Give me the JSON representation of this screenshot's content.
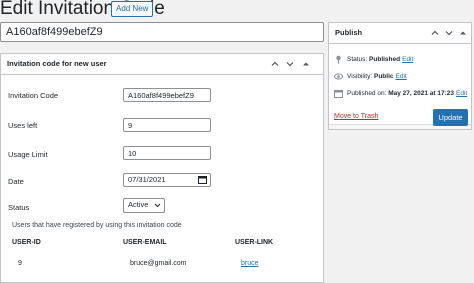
{
  "header": {
    "page_title": "Edit Invitation Code",
    "add_new_label": "Add New"
  },
  "post_title": "A160af8f499ebefZ9",
  "meta_box": {
    "title": "Invitation code for new user",
    "fields": {
      "invitation_code": {
        "label": "Invitation Code",
        "value": "A160af8f499ebefZ9"
      },
      "uses_left": {
        "label": "Uses left",
        "value": "9"
      },
      "usage_limit": {
        "label": "Usage Limit",
        "value": "10"
      },
      "date": {
        "label": "Date",
        "value": "07/31/2021"
      },
      "status": {
        "label": "Status",
        "value": "Active",
        "options": [
          "Active"
        ]
      }
    },
    "users_text": "Users that have registered by using this invitation code",
    "table": {
      "columns": [
        "USER-ID",
        "USER-EMAIL",
        "USER-LINK"
      ],
      "rows": [
        {
          "id": "9",
          "email": "bruce@gmail.com",
          "link": "bruce"
        }
      ]
    }
  },
  "publish": {
    "title": "Publish",
    "status_label": "Status:",
    "status_value": "Published",
    "visibility_label": "Visibility:",
    "visibility_value": "Public",
    "published_label": "Published on:",
    "published_value": "May 27, 2021 at 17:23",
    "edit_label": "Edit",
    "trash_label": "Move to Trash",
    "update_label": "Update"
  },
  "colors": {
    "accent": "#2271b1",
    "danger": "#b32d2e"
  },
  "icons": [
    "chevron-up-icon",
    "chevron-down-icon",
    "collapse-arrow-icon",
    "pin-icon",
    "eye-icon",
    "calendar-icon"
  ]
}
